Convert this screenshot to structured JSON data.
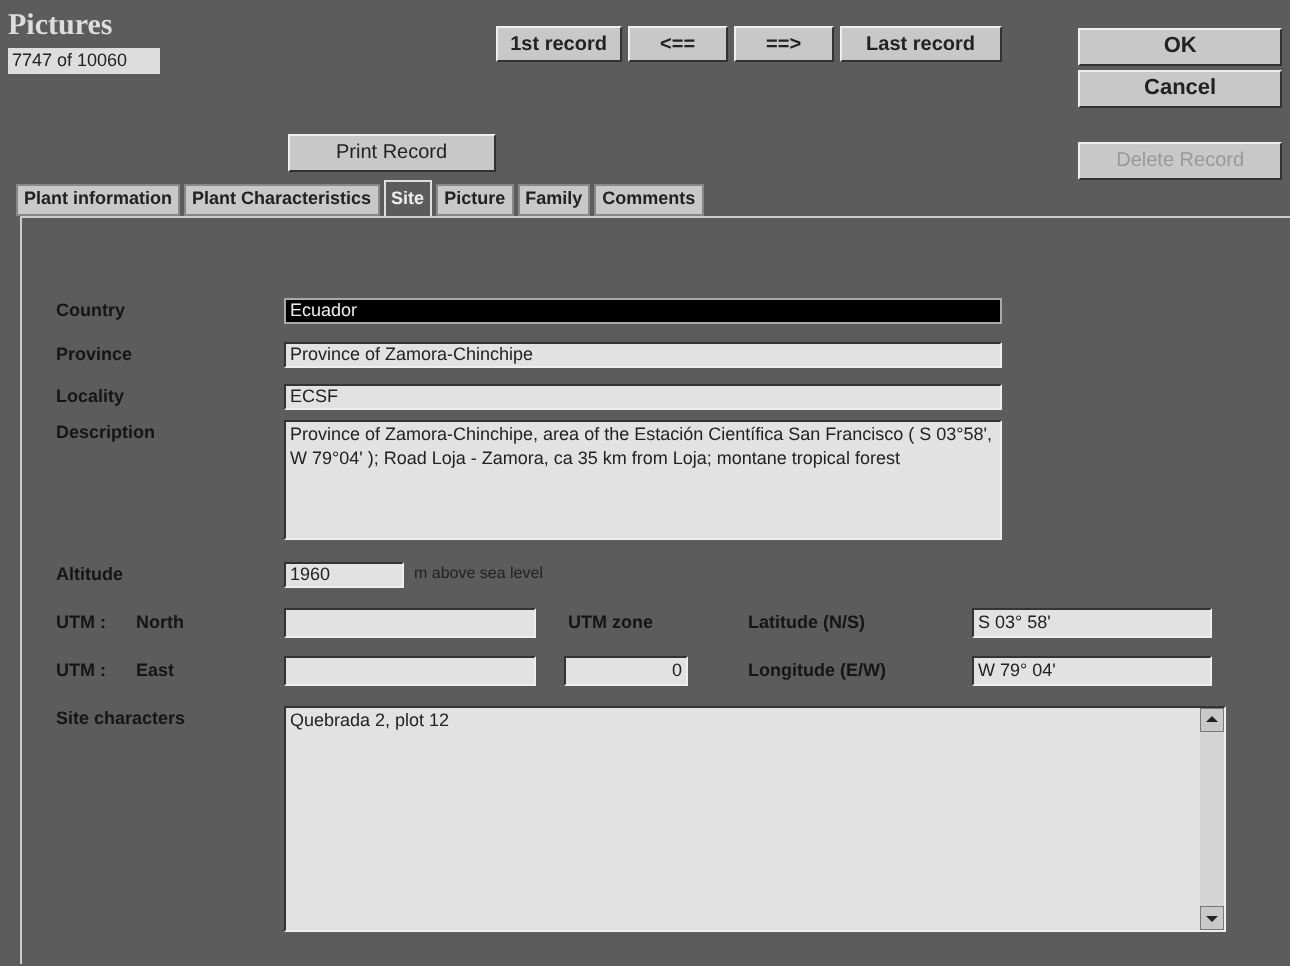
{
  "window": {
    "title": "Pictures"
  },
  "record_counter": "7747 of 10060",
  "nav_buttons": [
    "1st record",
    "<==",
    "==>",
    "Last record"
  ],
  "side_buttons": [
    {
      "label": "OK",
      "disabled": false
    },
    {
      "label": "Cancel",
      "disabled": false
    }
  ],
  "print_button": "Print Record",
  "delete_button": {
    "label": "Delete Record",
    "disabled": true
  },
  "tabs": [
    {
      "label": "Plant information",
      "selected": false
    },
    {
      "label": "Plant Characteristics",
      "selected": false
    },
    {
      "label": "Site",
      "selected": true
    },
    {
      "label": "Picture",
      "selected": false
    },
    {
      "label": "Family",
      "selected": false
    },
    {
      "label": "Comments",
      "selected": false
    }
  ],
  "site": {
    "fields": [
      {
        "label": "Country",
        "value": "Ecuador",
        "focused": true,
        "kind": "line"
      },
      {
        "label": "Province",
        "value": "Province of Zamora-Chinchipe",
        "focused": false,
        "kind": "line"
      },
      {
        "label": "Locality",
        "value": "ECSF",
        "focused": false,
        "kind": "line"
      },
      {
        "label": "Description",
        "value": "Province of Zamora-Chinchipe, area of the Estación Científica San Francisco ( S 03°58', W 79°04' ); Road Loja - Zamora, ca 35 km from Loja; montane tropical forest",
        "focused": false,
        "kind": "area"
      }
    ],
    "altitude": {
      "label": "Altitude",
      "value": "1960",
      "unit": "m above sea level"
    },
    "utm_north": {
      "label_1": "UTM :",
      "label_2": "North"
    },
    "utm_east": {
      "label_1": "UTM :",
      "label_2": "East"
    },
    "utm_zone": {
      "label_1": "UTM",
      "label_2": "zone",
      "value": "0"
    },
    "latitude": {
      "label": "Latitude (N/S)",
      "value": "S 03° 58'"
    },
    "longitude": {
      "label": "Longitude (E/W)",
      "value": "W 79° 04'"
    },
    "site_characters": {
      "label": "Site characters",
      "value": "Quebrada 2, plot 12"
    }
  }
}
